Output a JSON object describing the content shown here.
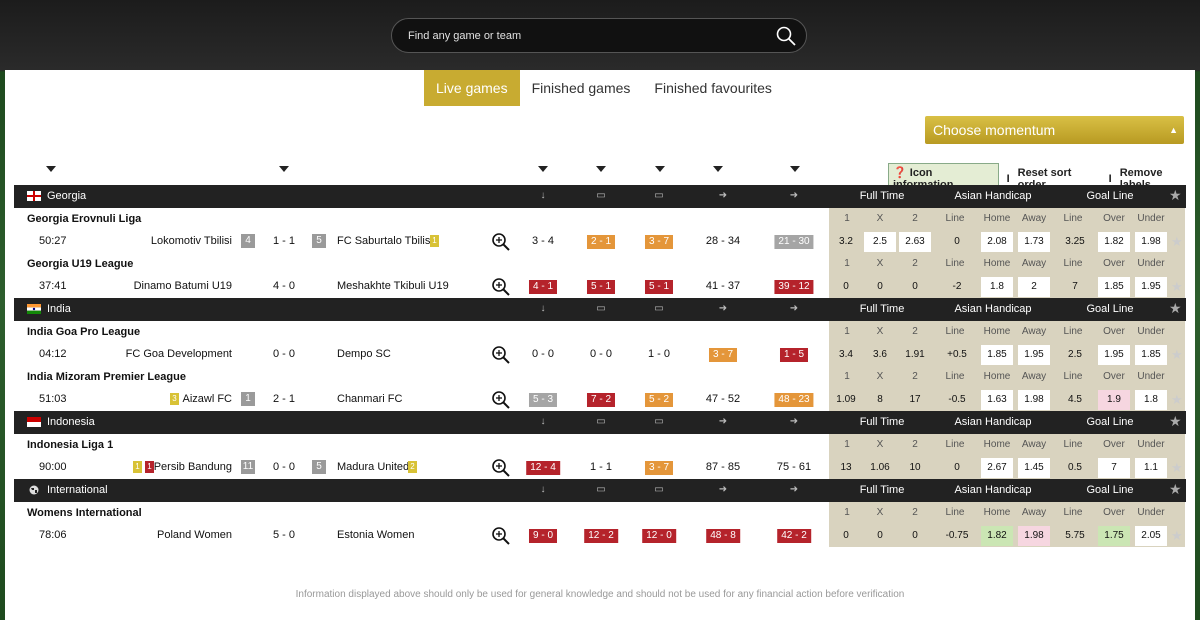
{
  "search": {
    "placeholder": "Find any game or team"
  },
  "tabs": [
    "Live games",
    "Finished games",
    "Finished favourites"
  ],
  "momentum": "Choose momentum",
  "links": {
    "icon_info": "Icon information",
    "sep": "I",
    "reset": "Reset sort order",
    "remove": "Remove labels"
  },
  "groups": [
    "Full Time",
    "Asian Handicap",
    "Goal Line"
  ],
  "odds_labels": [
    "1",
    "X",
    "2",
    "Line",
    "Home",
    "Away",
    "Line",
    "Over",
    "Under"
  ],
  "countries": [
    {
      "name": "Georgia",
      "leagues": [
        {
          "name": "Georgia Erovnuli Liga",
          "time": "50:27",
          "home": "Lokomotiv Tbilisi",
          "home_rank": "4",
          "score": "1 - 1",
          "away_rank": "5",
          "away": "FC Saburtalo Tbilisi",
          "away_y": "1",
          "stats": [
            "3 - 4",
            "2 - 1",
            "3 - 7",
            "28 - 34",
            "21 - 30"
          ],
          "odds": [
            "3.2",
            "2.5",
            "2.63",
            "0",
            "2.08",
            "1.73",
            "3.25",
            "1.82",
            "1.98"
          ]
        },
        {
          "name": "Georgia U19 League",
          "time": "37:41",
          "home": "Dinamo Batumi U19",
          "score": "4 - 0",
          "away": "Meshakhte Tkibuli U19",
          "stats": [
            "4 - 1",
            "5 - 1",
            "5 - 1",
            "41 - 37",
            "39 - 12"
          ],
          "odds": [
            "0",
            "0",
            "0",
            "-2",
            "1.8",
            "2",
            "7",
            "1.85",
            "1.95"
          ]
        }
      ]
    },
    {
      "name": "India",
      "leagues": [
        {
          "name": "India Goa Pro League",
          "time": "04:12",
          "home": "FC Goa Development",
          "score": "0 - 0",
          "away": "Dempo SC",
          "stats": [
            "0 - 0",
            "0 - 0",
            "1 - 0",
            "3 - 7",
            "1 - 5"
          ],
          "odds": [
            "3.4",
            "3.6",
            "1.91",
            "+0.5",
            "1.85",
            "1.95",
            "2.5",
            "1.95",
            "1.85"
          ]
        },
        {
          "name": "India Mizoram Premier League",
          "time": "51:03",
          "home": "Aizawl FC",
          "home_y": "3",
          "home_rank": "1",
          "score": "2 - 1",
          "away": "Chanmari FC",
          "stats": [
            "5 - 3",
            "7 - 2",
            "5 - 2",
            "47 - 52",
            "48 - 23"
          ],
          "odds": [
            "1.09",
            "8",
            "17",
            "-0.5",
            "1.63",
            "1.98",
            "4.5",
            "1.9",
            "1.8"
          ]
        }
      ]
    },
    {
      "name": "Indonesia",
      "leagues": [
        {
          "name": "Indonesia Liga 1",
          "time": "90:00",
          "home": "Persib Bandung",
          "home_y": "1",
          "home_r": "1",
          "home_rank": "11",
          "score": "0 - 0",
          "away_rank": "5",
          "away": "Madura United",
          "away_y": "2",
          "stats": [
            "12 - 4",
            "1 - 1",
            "3 - 7",
            "87 - 85",
            "75 - 61"
          ],
          "odds": [
            "13",
            "1.06",
            "10",
            "0",
            "2.67",
            "1.45",
            "0.5",
            "7",
            "1.1"
          ]
        }
      ]
    },
    {
      "name": "International",
      "leagues": [
        {
          "name": "Womens International",
          "time": "78:06",
          "home": "Poland Women",
          "score": "5 - 0",
          "away": "Estonia Women",
          "stats": [
            "9 - 0",
            "12 - 2",
            "12 - 0",
            "48 - 8",
            "42 - 2"
          ],
          "odds": [
            "0",
            "0",
            "0",
            "-0.75",
            "1.82",
            "1.98",
            "5.75",
            "1.75",
            "2.05"
          ]
        }
      ]
    }
  ],
  "footer": "Information displayed above should only be used for general knowledge and should not be used for any financial action before verification"
}
